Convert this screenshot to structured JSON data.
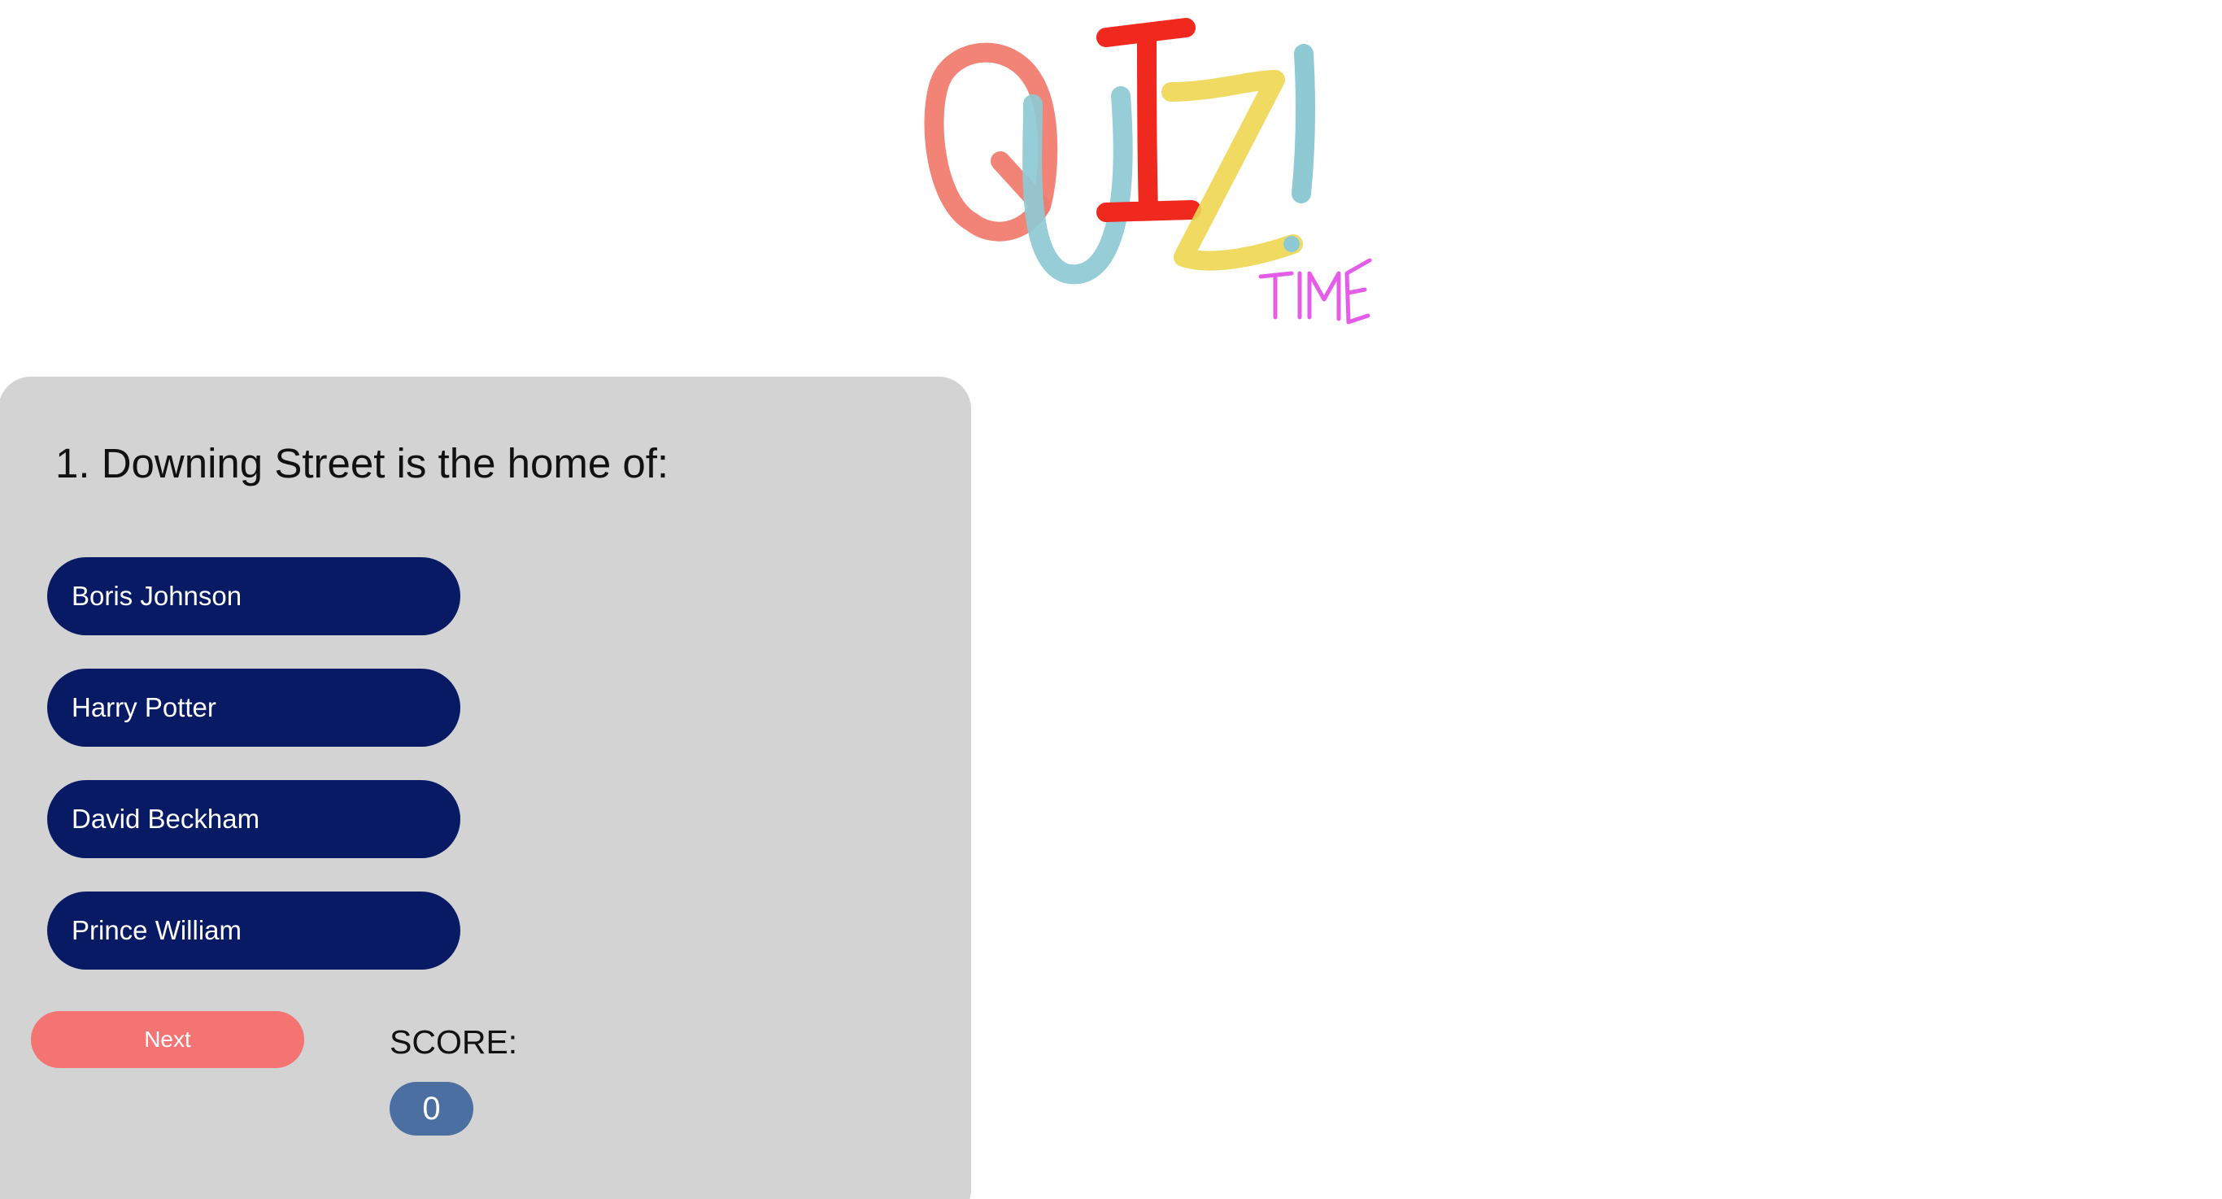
{
  "logo": {
    "text": "QUIZ! TIME",
    "colors": {
      "q": "#f07c70",
      "u": "#8ec9d4",
      "i": "#f0291e",
      "z": "#f0d650",
      "exclaim": "#8ec9d4",
      "time": "#e45ce8"
    }
  },
  "quiz": {
    "question": "1. Downing Street is the home of:",
    "answers": [
      {
        "label": "Boris Johnson"
      },
      {
        "label": "Harry Potter"
      },
      {
        "label": "David Beckham"
      },
      {
        "label": "Prince William"
      }
    ],
    "next_label": "Next",
    "score_label": "SCORE:",
    "score_value": "0"
  },
  "colors": {
    "panel": "#d3d3d3",
    "answer_button": "#071a63",
    "next_button": "#f47474",
    "score_badge": "#4a6fa0"
  }
}
